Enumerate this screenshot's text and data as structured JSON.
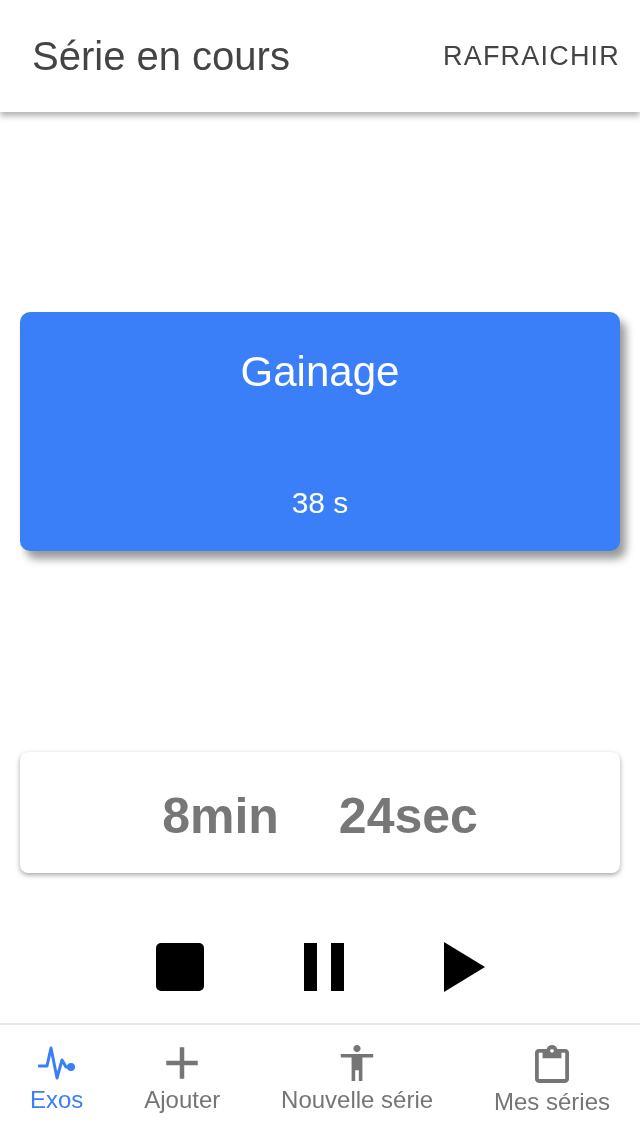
{
  "app_bar": {
    "title": "Série en cours",
    "action": "RAFRAICHIR"
  },
  "exercise_card": {
    "name": "Gainage",
    "duration": "38 s"
  },
  "timer": {
    "minutes": "8min",
    "seconds": "24sec"
  },
  "controls": [
    {
      "kind": "stop"
    },
    {
      "kind": "pause"
    },
    {
      "kind": "play"
    }
  ],
  "bottom_nav": [
    {
      "label": "Exos",
      "kind": "pulse",
      "selected": true
    },
    {
      "label": "Ajouter",
      "kind": "add",
      "selected": false
    },
    {
      "label": "Nouvelle série",
      "kind": "person",
      "selected": false
    },
    {
      "label": "Mes séries",
      "kind": "clipboard",
      "selected": false
    }
  ]
}
